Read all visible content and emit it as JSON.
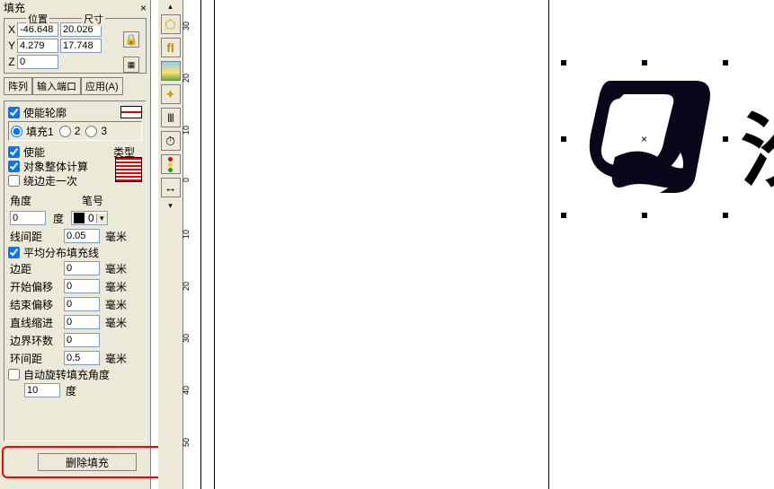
{
  "panel": {
    "title": "填充",
    "position_label": "位置",
    "size_label": "尺寸",
    "x": "X",
    "y": "Y",
    "z": "Z",
    "vals": {
      "x": "-46.648",
      "y": "4.279",
      "z": "0",
      "w": "20.026",
      "h": "17.748"
    },
    "btn_array": "阵列",
    "btn_input": "输入端口",
    "btn_apply": "应用(A)",
    "enable_outline": "使能轮廓",
    "fill1": "填充1",
    "opt2": "2",
    "opt3": "3",
    "enable": "使能",
    "type_label": "类型",
    "whole_calc": "对象整体计算",
    "around_once": "绕边走一次",
    "angle": "角度",
    "angle_val": "0",
    "degree": "度",
    "pen": "笔号",
    "pen_val": "0",
    "line_gap": "线间距",
    "line_gap_val": "0.05",
    "mm": "毫米",
    "avg_fill_line": "平均分布填充线",
    "edge_margin": "边距",
    "edge_margin_val": "0",
    "start_off": "开始偏移",
    "start_off_val": "0",
    "end_off": "结束偏移",
    "end_off_val": "0",
    "line_indent": "直线缩进",
    "line_indent_val": "0",
    "border_rings": "边界环数",
    "border_rings_val": "0",
    "ring_gap": "环间距",
    "ring_gap_val": "0.5",
    "auto_rot": "自动旋转填充角度",
    "auto_rot_val": "10",
    "degree2": "度",
    "delete_fill": "删除填充"
  },
  "ruler": {
    "labels": [
      "30",
      "20",
      "10",
      "0",
      "10",
      "20",
      "30",
      "40",
      "50"
    ]
  }
}
